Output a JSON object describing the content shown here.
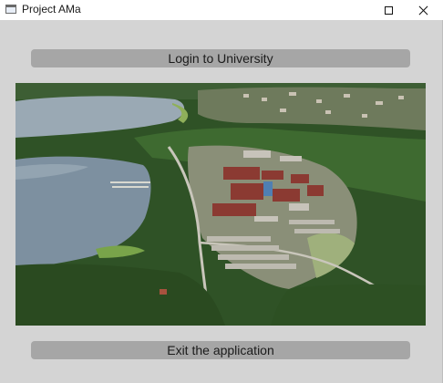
{
  "window": {
    "title": "Project AMa",
    "icon": "app-window-icon",
    "controls": {
      "maximize_icon": "maximize-icon",
      "close_icon": "close-icon"
    }
  },
  "main": {
    "login_button_label": "Login to University",
    "exit_button_label": "Exit the application",
    "image": {
      "description": "campus-aerial-photo",
      "colors": {
        "lake": "#8fa3b3",
        "forest": "#2f5a24",
        "roof": "#8b3a32",
        "field": "#a9b58a"
      }
    }
  }
}
